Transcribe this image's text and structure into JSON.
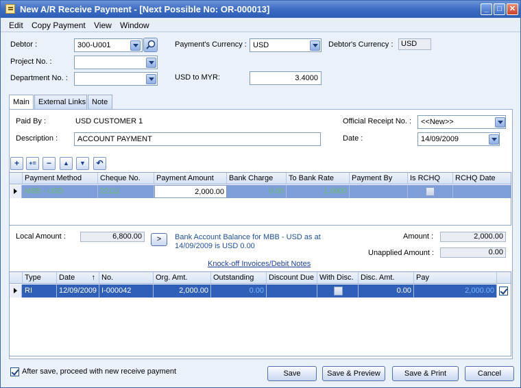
{
  "window": {
    "title": "New A/R Receive Payment - [Next Possible No: OR-000013]",
    "min_label": "_",
    "max_label": "□",
    "close_label": "✕"
  },
  "menu": [
    "Edit",
    "Copy Payment",
    "View",
    "Window"
  ],
  "header": {
    "debtor_label": "Debtor :",
    "debtor_value": "300-U001",
    "project_label": "Project No. :",
    "project_value": "",
    "department_label": "Department No. :",
    "department_value": "",
    "payment_currency_label": "Payment's Currency :",
    "payment_currency_value": "USD",
    "rate_label": "USD to MYR:",
    "rate_value": "3.4000",
    "debtor_currency_label": "Debtor's Currency :",
    "debtor_currency_value": "USD"
  },
  "tabs": [
    "Main",
    "External Links",
    "Note"
  ],
  "main": {
    "paid_by_label": "Paid By :",
    "paid_by_value": "USD CUSTOMER 1",
    "description_label": "Description :",
    "description_value": "ACCOUNT PAYMENT",
    "receipt_label": "Official Receipt No. :",
    "receipt_value": "<<New>>",
    "date_label": "Date :",
    "date_value": "14/09/2009"
  },
  "toolbar_icons": [
    "add-row-icon",
    "insert-row-icon",
    "delete-row-icon",
    "move-up-icon",
    "move-down-icon",
    "undo-icon"
  ],
  "payment_grid": {
    "columns": [
      "Payment Method",
      "Cheque No.",
      "Payment Amount",
      "Bank Charge",
      "To Bank Rate",
      "Payment By",
      "Is RCHQ",
      "RCHQ Date"
    ],
    "row": {
      "payment_method": "MBB - USD",
      "cheque_no": "22111",
      "payment_amount": "2,000.00",
      "bank_charge": "0.00",
      "to_bank_rate": "1.0000",
      "payment_by": "",
      "is_rchq": false,
      "rchq_date": ""
    }
  },
  "amounts": {
    "local_amount_label": "Local Amount :",
    "local_amount_value": "6,800.00",
    "goto_label": ">",
    "bank_balance_text_1": "Bank Account Balance for MBB - USD as at",
    "bank_balance_text_2": "14/09/2009 is USD 0.00",
    "amount_label": "Amount :",
    "amount_value": "2,000.00",
    "unapplied_label": "Unapplied Amount :",
    "unapplied_value": "0.00",
    "knockoff_link": "Knock-off Invoices/Debit Notes"
  },
  "knockoff_grid": {
    "columns": [
      "Type",
      "Date",
      "No.",
      "Org. Amt.",
      "Outstanding",
      "Discount Due",
      "With Disc.",
      "Disc. Amt.",
      "Pay"
    ],
    "sort_indicator": "↑",
    "row": {
      "type": "RI",
      "date": "12/09/2009",
      "no": "I-000042",
      "org_amt": "2,000.00",
      "outstanding": "0.00",
      "discount_due": "",
      "with_disc": false,
      "disc_amt": "0.00",
      "pay": "2,000.00",
      "selected": true
    }
  },
  "footer": {
    "proceed_label": "After save, proceed with new receive payment",
    "proceed_checked": true,
    "save": "Save",
    "save_preview": "Save & Preview",
    "save_print": "Save & Print",
    "cancel": "Cancel"
  },
  "colors": {
    "title_bar": "#3c6cc4",
    "grid_selection": "#7d9ed8",
    "green_value": "#6dbb6d",
    "blue_value": "#2d7fe0"
  }
}
